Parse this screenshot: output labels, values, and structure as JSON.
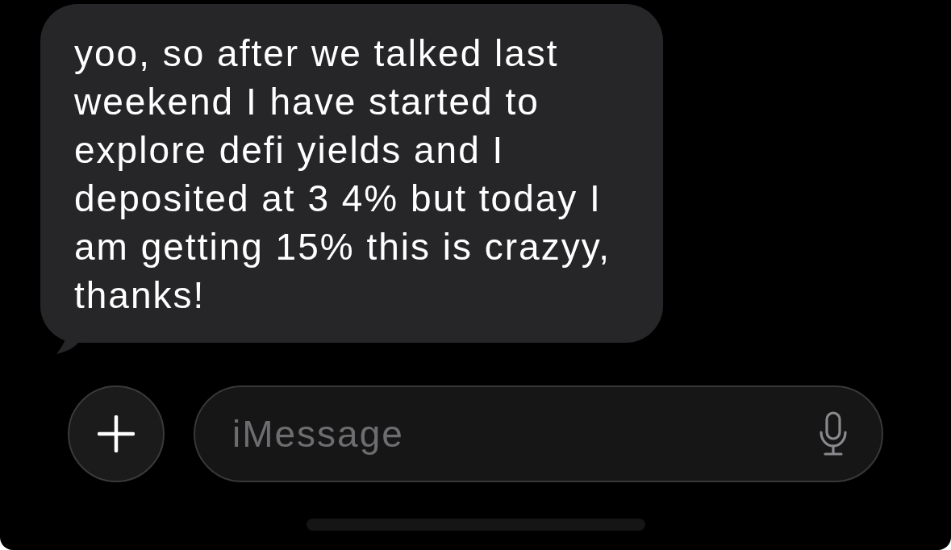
{
  "messages": [
    {
      "kind": "received",
      "text": "yoo, so after we talked last weekend I have started to explore defi yields and I deposited at 3 4% but today I am getting 15% this is crazyy, thanks!"
    }
  ],
  "composer": {
    "placeholder": "iMessage"
  }
}
